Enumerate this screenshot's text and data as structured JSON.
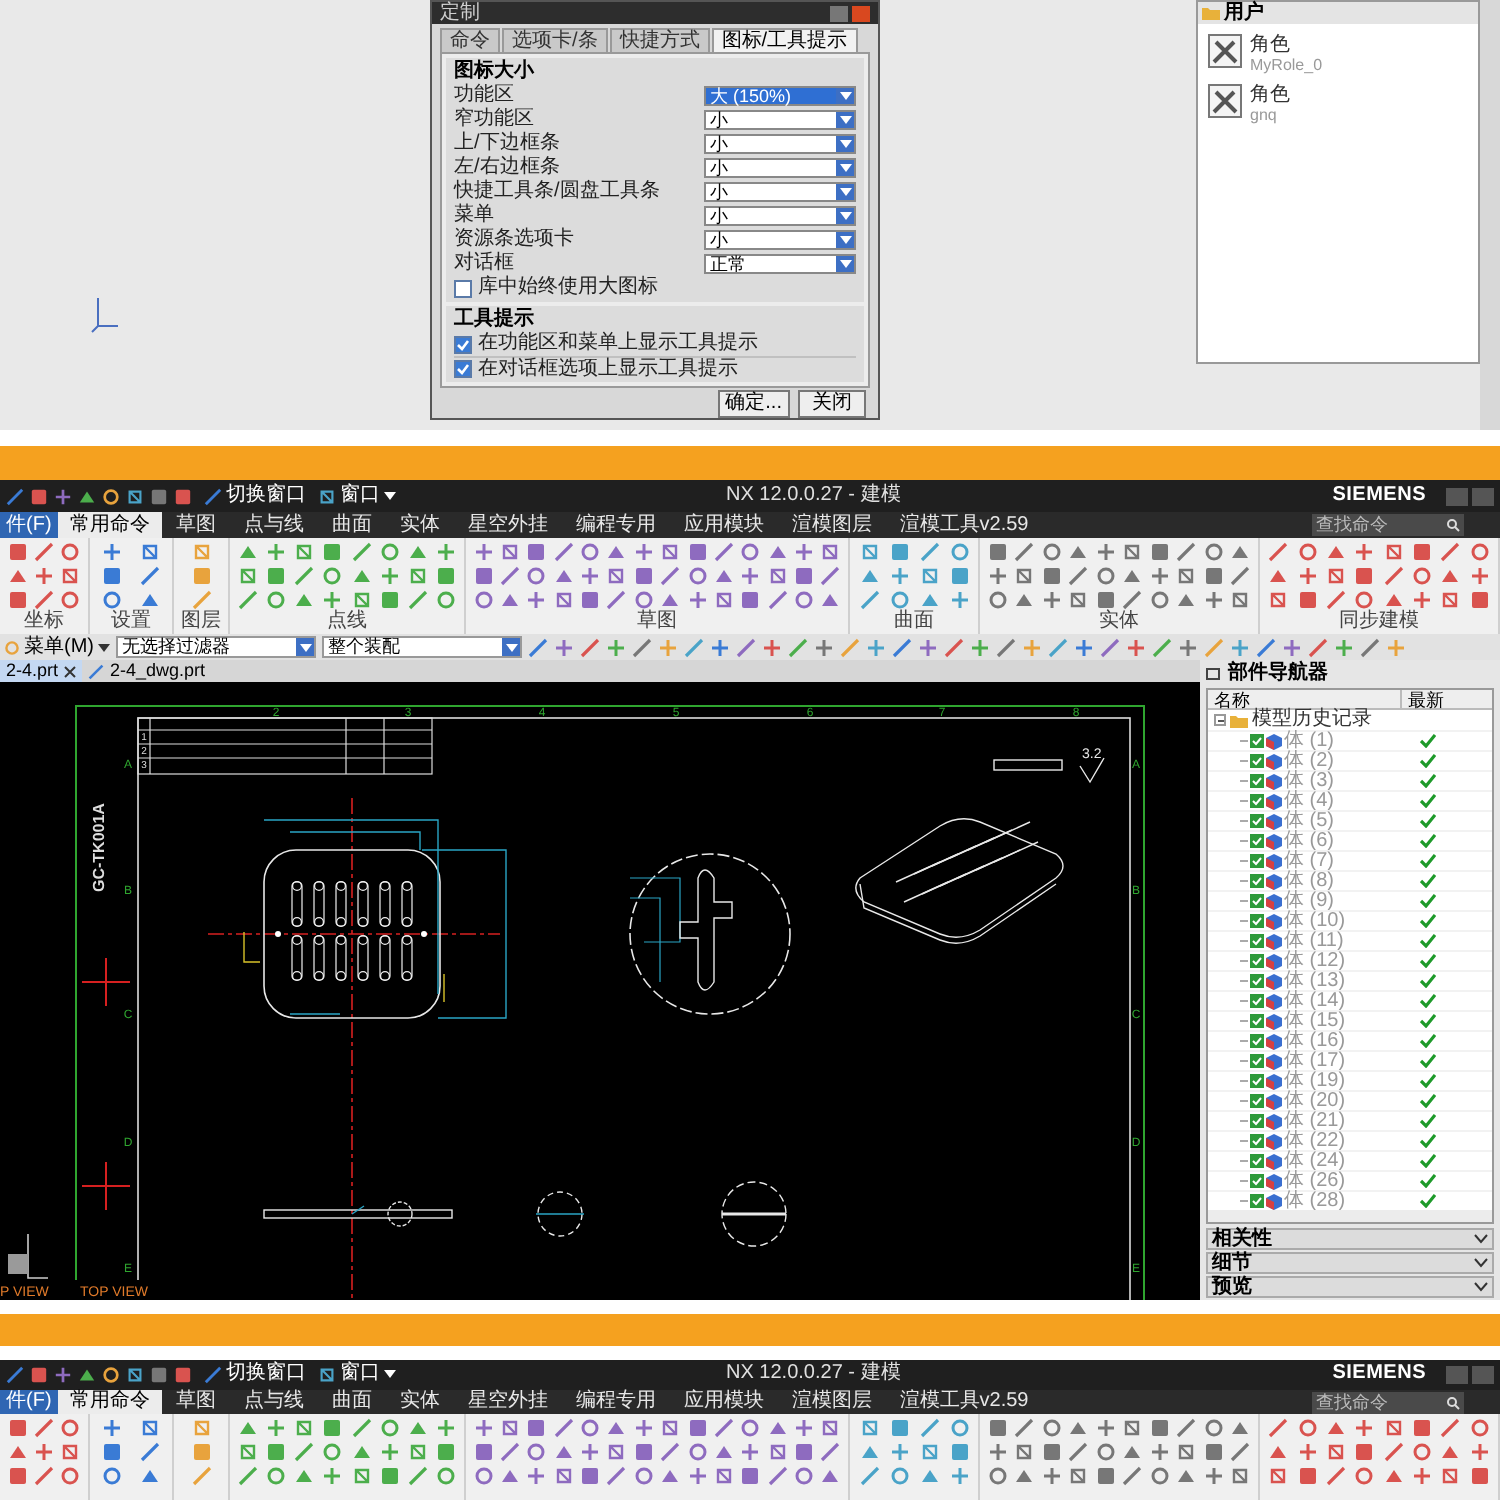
{
  "top_screenshot": {
    "dialog": {
      "title": "定制",
      "tabs": [
        {
          "label": "命令",
          "selected": false
        },
        {
          "label": "选项卡/条",
          "selected": false
        },
        {
          "label": "快捷方式",
          "selected": false
        },
        {
          "label": "图标/工具提示",
          "selected": true
        }
      ],
      "icon_size": {
        "title": "图标大小",
        "rows": [
          {
            "label": "功能区",
            "value": "大 (150%)",
            "selected": true
          },
          {
            "label": "窄功能区",
            "value": "小",
            "selected": false
          },
          {
            "label": "上/下边框条",
            "value": "小",
            "selected": false
          },
          {
            "label": "左/右边框条",
            "value": "小",
            "selected": false
          },
          {
            "label": "快捷工具条/圆盘工具条",
            "value": "小",
            "selected": false
          },
          {
            "label": "菜单",
            "value": "小",
            "selected": false
          },
          {
            "label": "资源条选项卡",
            "value": "小",
            "selected": false
          },
          {
            "label": "对话框",
            "value": "正常",
            "selected": false
          }
        ],
        "option": {
          "label": "库中始终使用大图标",
          "checked": false
        }
      },
      "tooltips": {
        "title": "工具提示",
        "options": [
          {
            "label": "在功能区和菜单上显示工具提示",
            "checked": true
          },
          {
            "label": "在对话框选项上显示工具提示",
            "checked": true
          }
        ]
      },
      "buttons": [
        "确定...",
        "关闭"
      ]
    },
    "user_panel": {
      "title": "用户",
      "items": [
        {
          "title": "角色",
          "subtitle": "MyRole_0"
        },
        {
          "title": "角色",
          "subtitle": "gnq"
        }
      ]
    }
  },
  "nx_window": {
    "title_bar": {
      "switch_window": "切换窗口",
      "window_menu": "窗口",
      "title": "NX 12.0.0.27 - 建模",
      "brand": "SIEMENS"
    },
    "ribbon_tabs": [
      {
        "label": "件(F)",
        "kind": "file",
        "selected": false
      },
      {
        "label": "常用命令",
        "kind": "tab",
        "selected": true
      },
      {
        "label": "草图",
        "kind": "tab",
        "selected": false
      },
      {
        "label": "点与线",
        "kind": "tab",
        "selected": false
      },
      {
        "label": "曲面",
        "kind": "tab",
        "selected": false
      },
      {
        "label": "实体",
        "kind": "tab",
        "selected": false
      },
      {
        "label": "星空外挂",
        "kind": "tab",
        "selected": false
      },
      {
        "label": "编程专用",
        "kind": "tab",
        "selected": false
      },
      {
        "label": "应用模块",
        "kind": "tab",
        "selected": false
      },
      {
        "label": "渲模图层",
        "kind": "tab",
        "selected": false
      },
      {
        "label": "渲模工具v2.59",
        "kind": "tab",
        "selected": false
      }
    ],
    "search": {
      "placeholder": "查找命令"
    },
    "ribbon_groups": [
      "坐标",
      "设置",
      "图层",
      "点线",
      "草图",
      "曲面",
      "实体",
      "同步建模"
    ],
    "toolbar": {
      "menu": "菜单(M)",
      "filter": "无选择过滤器",
      "scope": "整个装配"
    },
    "doc_tabs": [
      {
        "label": "2-4.prt",
        "selected": true
      },
      {
        "label": "2-4_dwg.prt",
        "selected": false
      }
    ],
    "drawing": {
      "sheet_code": "GC-TK001A",
      "columns": [
        "2",
        "3",
        "4",
        "5",
        "6",
        "7",
        "8"
      ],
      "rows_left": [
        "A",
        "B",
        "C",
        "D",
        "E"
      ],
      "rows_right": [
        "A",
        "B",
        "C",
        "D",
        "E"
      ],
      "title_block_rows": [
        "1",
        "2",
        "3"
      ],
      "roughness": "3.2",
      "view_labels": [
        "P VIEW",
        "TOP VIEW"
      ]
    },
    "navigator": {
      "title": "部件导航器",
      "columns": [
        "名称",
        "最新"
      ],
      "root": {
        "label": "模型历史记录",
        "expanded": true,
        "children": [
          {
            "label": "体 (1)",
            "visible": true,
            "latest": true
          },
          {
            "label": "体 (2)",
            "visible": true,
            "latest": true
          },
          {
            "label": "体 (3)",
            "visible": true,
            "latest": true
          },
          {
            "label": "体 (4)",
            "visible": true,
            "latest": true
          },
          {
            "label": "体 (5)",
            "visible": true,
            "latest": true
          },
          {
            "label": "体 (6)",
            "visible": true,
            "latest": true
          },
          {
            "label": "体 (7)",
            "visible": true,
            "latest": true
          },
          {
            "label": "体 (8)",
            "visible": true,
            "latest": true
          },
          {
            "label": "体 (9)",
            "visible": true,
            "latest": true
          },
          {
            "label": "体 (10)",
            "visible": true,
            "latest": true
          },
          {
            "label": "体 (11)",
            "visible": true,
            "latest": true
          },
          {
            "label": "体 (12)",
            "visible": true,
            "latest": true
          },
          {
            "label": "体 (13)",
            "visible": true,
            "latest": true
          },
          {
            "label": "体 (14)",
            "visible": true,
            "latest": true
          },
          {
            "label": "体 (15)",
            "visible": true,
            "latest": true
          },
          {
            "label": "体 (16)",
            "visible": true,
            "latest": true
          },
          {
            "label": "体 (17)",
            "visible": true,
            "latest": true
          },
          {
            "label": "体 (19)",
            "visible": true,
            "latest": true
          },
          {
            "label": "体 (20)",
            "visible": true,
            "latest": true
          },
          {
            "label": "体 (21)",
            "visible": true,
            "latest": true
          },
          {
            "label": "体 (22)",
            "visible": true,
            "latest": true
          },
          {
            "label": "体 (24)",
            "visible": true,
            "latest": true
          },
          {
            "label": "体 (26)",
            "visible": true,
            "latest": true
          },
          {
            "label": "体 (28)",
            "visible": true,
            "latest": true
          }
        ]
      },
      "sections": [
        "相关性",
        "细节",
        "预览"
      ]
    }
  },
  "nx_window_bottom": {
    "title_bar": {
      "switch_window": "切换窗口",
      "window_menu": "窗口",
      "title": "NX 12.0.0.27 - 建模",
      "brand": "SIEMENS"
    },
    "ribbon_tabs": [
      {
        "label": "件(F)",
        "kind": "file",
        "selected": false
      },
      {
        "label": "常用命令",
        "kind": "tab",
        "selected": true
      },
      {
        "label": "草图",
        "kind": "tab",
        "selected": false
      },
      {
        "label": "点与线",
        "kind": "tab",
        "selected": false
      },
      {
        "label": "曲面",
        "kind": "tab",
        "selected": false
      },
      {
        "label": "实体",
        "kind": "tab",
        "selected": false
      },
      {
        "label": "星空外挂",
        "kind": "tab",
        "selected": false
      },
      {
        "label": "编程专用",
        "kind": "tab",
        "selected": false
      },
      {
        "label": "应用模块",
        "kind": "tab",
        "selected": false
      },
      {
        "label": "渲模图层",
        "kind": "tab",
        "selected": false
      },
      {
        "label": "渲模工具v2.59",
        "kind": "tab",
        "selected": false
      }
    ],
    "search": {
      "placeholder": "查找命令"
    }
  }
}
